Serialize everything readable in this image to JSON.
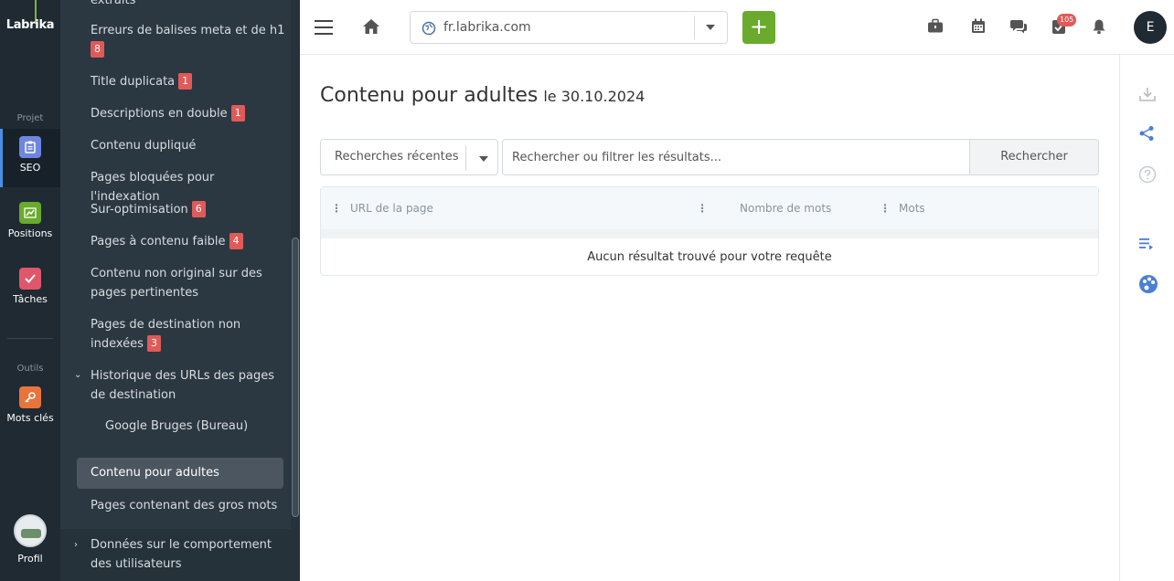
{
  "rail": {
    "logo": "Labrika",
    "section_project": "Projet",
    "section_tools": "Outils",
    "items": [
      {
        "label": "SEO",
        "icon": "clipboard-icon",
        "color": "#6f86e0"
      },
      {
        "label": "Positions",
        "icon": "chart-icon",
        "color": "#6aaa2d"
      },
      {
        "label": "Tâches",
        "icon": "check-icon",
        "color": "#e0566b"
      },
      {
        "label": "Mots clés",
        "icon": "key-icon",
        "color": "#e8743b"
      }
    ],
    "profile_label": "Profil"
  },
  "sidebar": {
    "partial_top": "extraits",
    "items": [
      {
        "label": "Erreurs de balises meta et de h1",
        "badge": "8"
      },
      {
        "label": "Title duplicata",
        "badge": "1"
      },
      {
        "label": "Descriptions en double",
        "badge": "1"
      },
      {
        "label": "Contenu dupliqué",
        "badge": ""
      },
      {
        "label": "Pages bloquées pour l'indexation",
        "badge": ""
      },
      {
        "label": "Sur-optimisation",
        "badge": "6"
      },
      {
        "label": "Pages à contenu faible",
        "badge": "4"
      },
      {
        "label": "Contenu non original sur des pages pertinentes",
        "badge": ""
      },
      {
        "label": "Pages de destination non indexées",
        "badge": "3"
      }
    ],
    "history_group": "Historique des URLs des pages de destination",
    "history_sub": "Google Bruges (Bureau)",
    "active_item": "Contenu pour adultes",
    "after_active": "Pages contenant des gros mots",
    "footer_group": "Données sur le comportement des utilisateurs"
  },
  "topbar": {
    "domain": "fr.labrika.com",
    "add_label": "+",
    "notif_count": "105",
    "user_initial": "E"
  },
  "main": {
    "title": "Contenu pour adultes",
    "date": "le 30.10.2024",
    "recent_searches": "Recherches récentes",
    "search_placeholder": "Rechercher ou filtrer les résultats...",
    "search_button": "Rechercher",
    "columns": [
      "URL de la page",
      "Nombre de mots",
      "Mots"
    ],
    "empty_message": "Aucun résultat trouvé pour votre requête"
  },
  "colors": {
    "accent_green": "#6aaa2d",
    "badge_red": "#e05a5a",
    "right_icon_blue": "#4a7fd6"
  }
}
